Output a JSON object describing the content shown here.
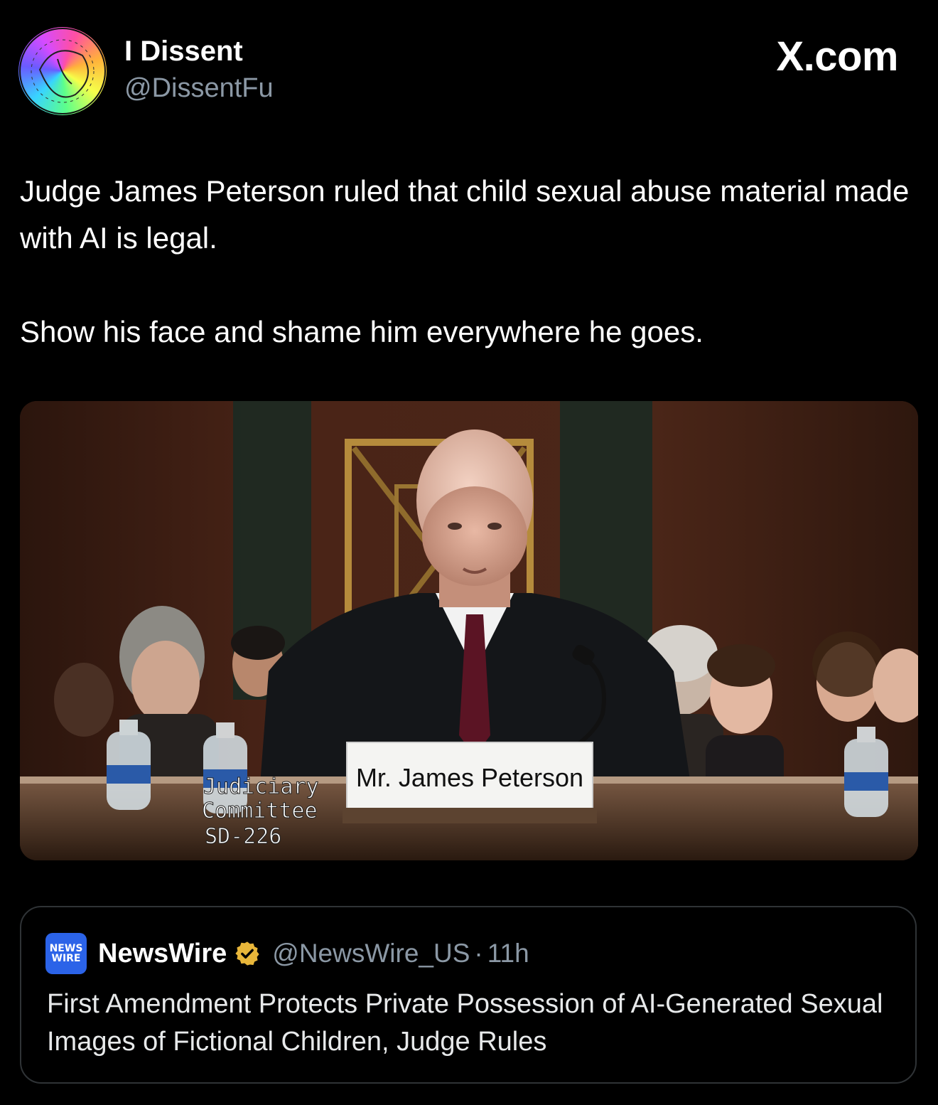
{
  "author": {
    "display_name": "I Dissent",
    "handle": "@DissentFu",
    "avatar_text": [
      "this",
      "is",
      "not",
      "the",
      "Property",
      "of the",
      "government"
    ]
  },
  "brand": "X.com",
  "tweet": {
    "paragraphs": [
      "Judge James Peterson ruled that child sexual abuse material made with AI is legal.",
      "Show his face and shame him everywhere he goes."
    ]
  },
  "media": {
    "nameplate": "Mr. James Peterson",
    "sign_lines": [
      "Judiciary",
      "Committee",
      "SD-226"
    ]
  },
  "quoted_tweet": {
    "avatar_lines": [
      "NEWS",
      "WIRE"
    ],
    "name": "NewsWire",
    "handle": "@NewsWire_US",
    "separator": "·",
    "time": "11h",
    "text": "First Amendment Protects Private Possession of AI-Generated Sexual Images of Fictional Children, Judge Rules"
  },
  "colors": {
    "background": "#000000",
    "text_primary": "#ffffff",
    "text_secondary": "#8b98a5",
    "border": "#2f3336",
    "verified": "#e8b63a"
  }
}
